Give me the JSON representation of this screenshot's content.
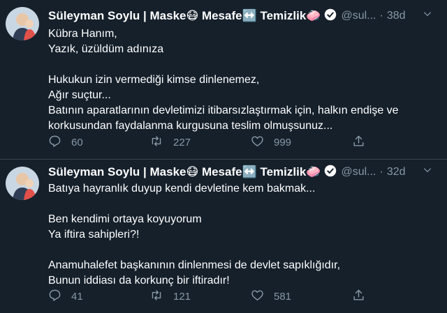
{
  "tweets": [
    {
      "name": "Süleyman Soylu | Maske😷 Mesafe↔️ Temizlik🧼",
      "handle": "@sul...",
      "separator": "·",
      "time": "38d",
      "lines": [
        "Kübra Hanım,",
        "Yazık, üzüldüm adınıza",
        "",
        "Hukukun izin vermediği kimse dinlenemez,",
        "Ağır suçtur...",
        "Batının aparatlarının devletimizi itibarsızlaştırmak için, halkın endişe ve",
        "korkusundan faydalanma kurgusuna teslim olmuşsunuz..."
      ],
      "replies": "60",
      "retweets": "227",
      "likes": "999"
    },
    {
      "name": "Süleyman Soylu | Maske😷 Mesafe↔️ Temizlik🧼",
      "handle": "@sul...",
      "separator": "·",
      "time": "32d",
      "lines": [
        "Batıya hayranlık duyup kendi devletine kem bakmak...",
        "",
        "Ben kendimi ortaya koyuyorum",
        "Ya iftira sahipleri?!",
        "",
        "Anamuhalefet başkanının dinlenmesi de devlet sapıklığıdır,",
        "Bunun iddiası da korkunç bir iftiradır!"
      ],
      "replies": "41",
      "retweets": "121",
      "likes": "581"
    }
  ],
  "colors": {
    "background": "#15202b",
    "text": "#ffffff",
    "muted": "#8899a6",
    "divider": "#38444d"
  },
  "icons": [
    "reply-icon",
    "retweet-icon",
    "like-icon",
    "share-icon",
    "verified-badge-icon",
    "chevron-down-icon"
  ]
}
